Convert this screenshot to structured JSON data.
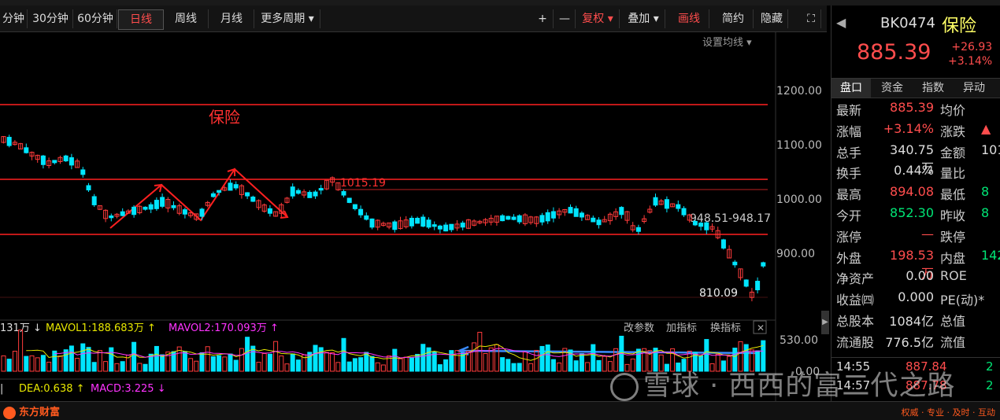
{
  "toolbar": {
    "periods": [
      "分钟",
      "30分钟",
      "60分钟",
      "日线",
      "周线",
      "月线",
      "更多周期 ▾"
    ],
    "active_period": "日线",
    "right_buttons": [
      "+",
      "—",
      "复权 ▾",
      "叠加 ▾",
      "画线",
      "简约",
      "隐藏"
    ],
    "setting_ma": "设置均线 ▾"
  },
  "chart": {
    "annotation_title": "保险",
    "label_1015": "1015.19",
    "label_range": "948.51-948.17",
    "label_low": "810.09",
    "y_ticks": [
      "1200.00",
      "1100.00",
      "1000.00",
      "900.00"
    ],
    "volume_ticks": [
      "530.00",
      "0.00"
    ],
    "volume_legend": {
      "vol": "131万 ↓",
      "mavol1": "MAVOL1:188.683万 ↑",
      "mavol2": "MAVOL2:170.093万 ↑"
    },
    "volume_buttons": [
      "改参数",
      "加指标",
      "换指标"
    ],
    "macd_legend": {
      "dea": "DEA:0.638 ↑",
      "macd": "MACD:3.225 ↓"
    },
    "colors": {
      "up": "#ff3b3b",
      "down": "#00e5ff",
      "hline": "#ff2020",
      "mavol1": "#e6e600",
      "mavol2": "#ff33ff",
      "blue_arrow": "#3a8cff"
    }
  },
  "side": {
    "code": "BK0474",
    "name": "保险",
    "price": "885.39",
    "change": "+26.93",
    "change_pct": "+3.14%",
    "tabs": [
      "盘口",
      "资金",
      "指数",
      "异动"
    ],
    "active_tab": "盘口",
    "rows": [
      {
        "l1": "最新",
        "v1": "885.39",
        "c1": "red",
        "l2": "均价",
        "v2": ""
      },
      {
        "l1": "涨幅",
        "v1": "+3.14%",
        "c1": "red",
        "l2": "涨跌",
        "v2": "▲"
      },
      {
        "l1": "总手",
        "v1": "340.75万",
        "c1": "white",
        "l2": "金额",
        "v2": "101"
      },
      {
        "l1": "换手",
        "v1": "0.44%",
        "c1": "white",
        "l2": "量比",
        "v2": ""
      },
      {
        "l1": "最高",
        "v1": "894.08",
        "c1": "red",
        "l2": "最低",
        "v2": "8"
      },
      {
        "l1": "今开",
        "v1": "852.30",
        "c1": "green",
        "l2": "昨收",
        "v2": "8"
      },
      {
        "l1": "涨停",
        "v1": "—",
        "c1": "red",
        "l2": "跌停",
        "v2": ""
      },
      {
        "l1": "外盘",
        "v1": "198.53万",
        "c1": "red",
        "l2": "内盘",
        "v2": "142"
      },
      {
        "l1": "净资产",
        "v1": "0.00",
        "c1": "white",
        "l2": "ROE",
        "v2": ""
      },
      {
        "l1": "收益㈣",
        "v1": "0.000",
        "c1": "white",
        "l2": "PE(动)*",
        "v2": ""
      },
      {
        "l1": "总股本",
        "v1": "1084亿",
        "c1": "white",
        "l2": "总值",
        "v2": ""
      },
      {
        "l1": "流通股",
        "v1": "776.5亿",
        "c1": "white",
        "l2": "流值",
        "v2": ""
      }
    ],
    "ticks": [
      {
        "time": "14:55",
        "price": "887.84",
        "extra": "2"
      },
      {
        "time": "14:57",
        "price": "887.78",
        "extra": "2"
      }
    ]
  },
  "brand": {
    "logo": "东方财富",
    "slogan": "权威 · 专业 · 及时 · 互动"
  },
  "watermark": "雪球 · 西西的富二代之路"
}
